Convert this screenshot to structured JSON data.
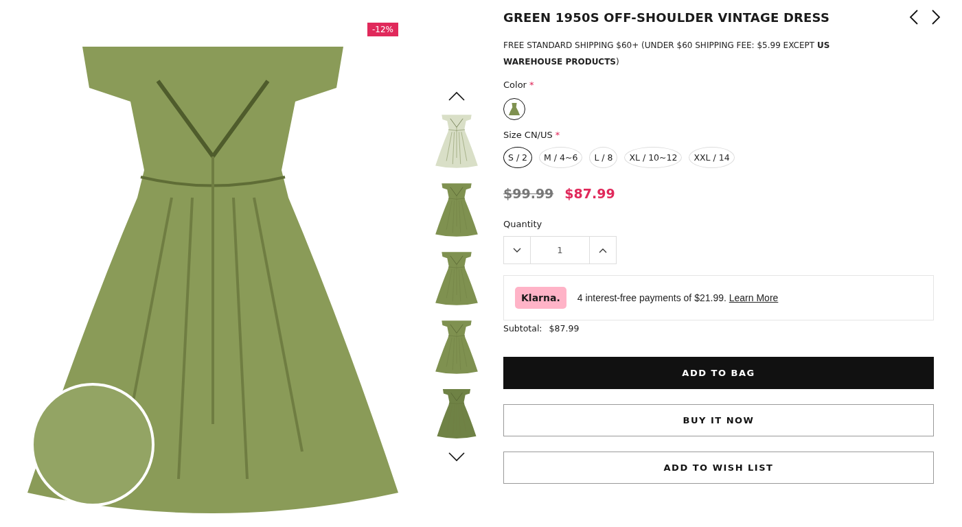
{
  "gallery": {
    "badge": "-12%"
  },
  "product": {
    "title": "GREEN 1950S OFF-SHOULDER VINTAGE DRESS",
    "shipping": "FREE STANDARD SHIPPING $60+ (UNDER $60 SHIPPING FEE: $5.99 EXCEPT **US WAREHOUSE PRODUCTS**)",
    "color_label": "Color",
    "color_required": "*",
    "swatches": [
      {
        "selected": true
      }
    ],
    "size_label": "Size CN/US",
    "size_required": "*",
    "sizes": [
      {
        "label": "S / 2",
        "selected": true
      },
      {
        "label": "M / 4~6",
        "selected": false
      },
      {
        "label": "L / 8",
        "selected": false
      },
      {
        "label": "XL / 10~12",
        "selected": false
      },
      {
        "label": "XXL / 14",
        "selected": false
      }
    ],
    "old_price": "$99.99",
    "price": "$87.99",
    "quantity_label": "Quantity",
    "quantity": "1",
    "klarna": {
      "logo": "Klarna.",
      "text": "4 interest-free payments of $21.99.",
      "link": "Learn More"
    },
    "subtotal_label": "Subtotal:",
    "subtotal": "$87.99",
    "buttons": [
      {
        "label": "ADD TO BAG",
        "kind": "primary"
      },
      {
        "label": "BUY IT NOW",
        "kind": "outline"
      },
      {
        "label": "ADD TO WISH LIST",
        "kind": "outline"
      }
    ]
  }
}
